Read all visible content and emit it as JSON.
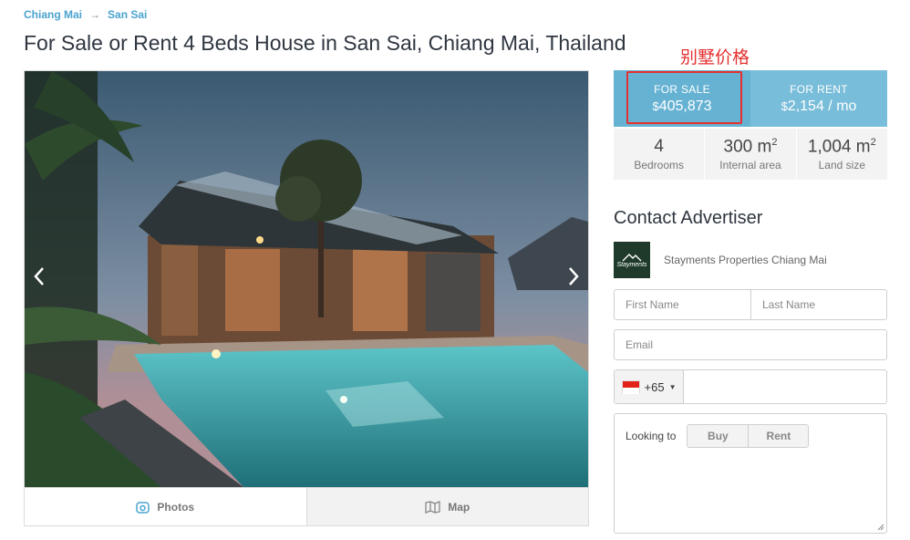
{
  "breadcrumb": {
    "items": [
      "Chiang Mai",
      "San Sai"
    ],
    "separator": "→"
  },
  "title": "For Sale or Rent 4 Beds House in San Sai, Chiang Mai, Thailand",
  "gallery": {
    "tabs": [
      {
        "label": "Photos",
        "icon": "camera-icon"
      },
      {
        "label": "Map",
        "icon": "map-icon"
      }
    ]
  },
  "price": {
    "sale_label": "FOR SALE",
    "sale_currency": "$",
    "sale_value": "405,873",
    "rent_label": "FOR RENT",
    "rent_currency": "$",
    "rent_value": "2,154 / mo"
  },
  "stats": [
    {
      "value": "4",
      "unit": "",
      "caption": "Bedrooms"
    },
    {
      "value": "300 m",
      "unit": "2",
      "caption": "Internal area"
    },
    {
      "value": "1,004 m",
      "unit": "2",
      "caption": "Land size"
    }
  ],
  "annotation": "别墅价格",
  "contact": {
    "title": "Contact Advertiser",
    "advertiser": "Stayments Properties Chiang Mai",
    "logo_text": "Stayments",
    "first_name_placeholder": "First Name",
    "last_name_placeholder": "Last Name",
    "email_placeholder": "Email",
    "phone_code": "+65",
    "looking_label": "Looking to",
    "options": [
      "Buy",
      "Rent"
    ]
  },
  "colors": {
    "accent": "#78bdd9",
    "accent_dark": "#66b2d3",
    "annotation": "#e53030",
    "link": "#4aa3cf"
  }
}
